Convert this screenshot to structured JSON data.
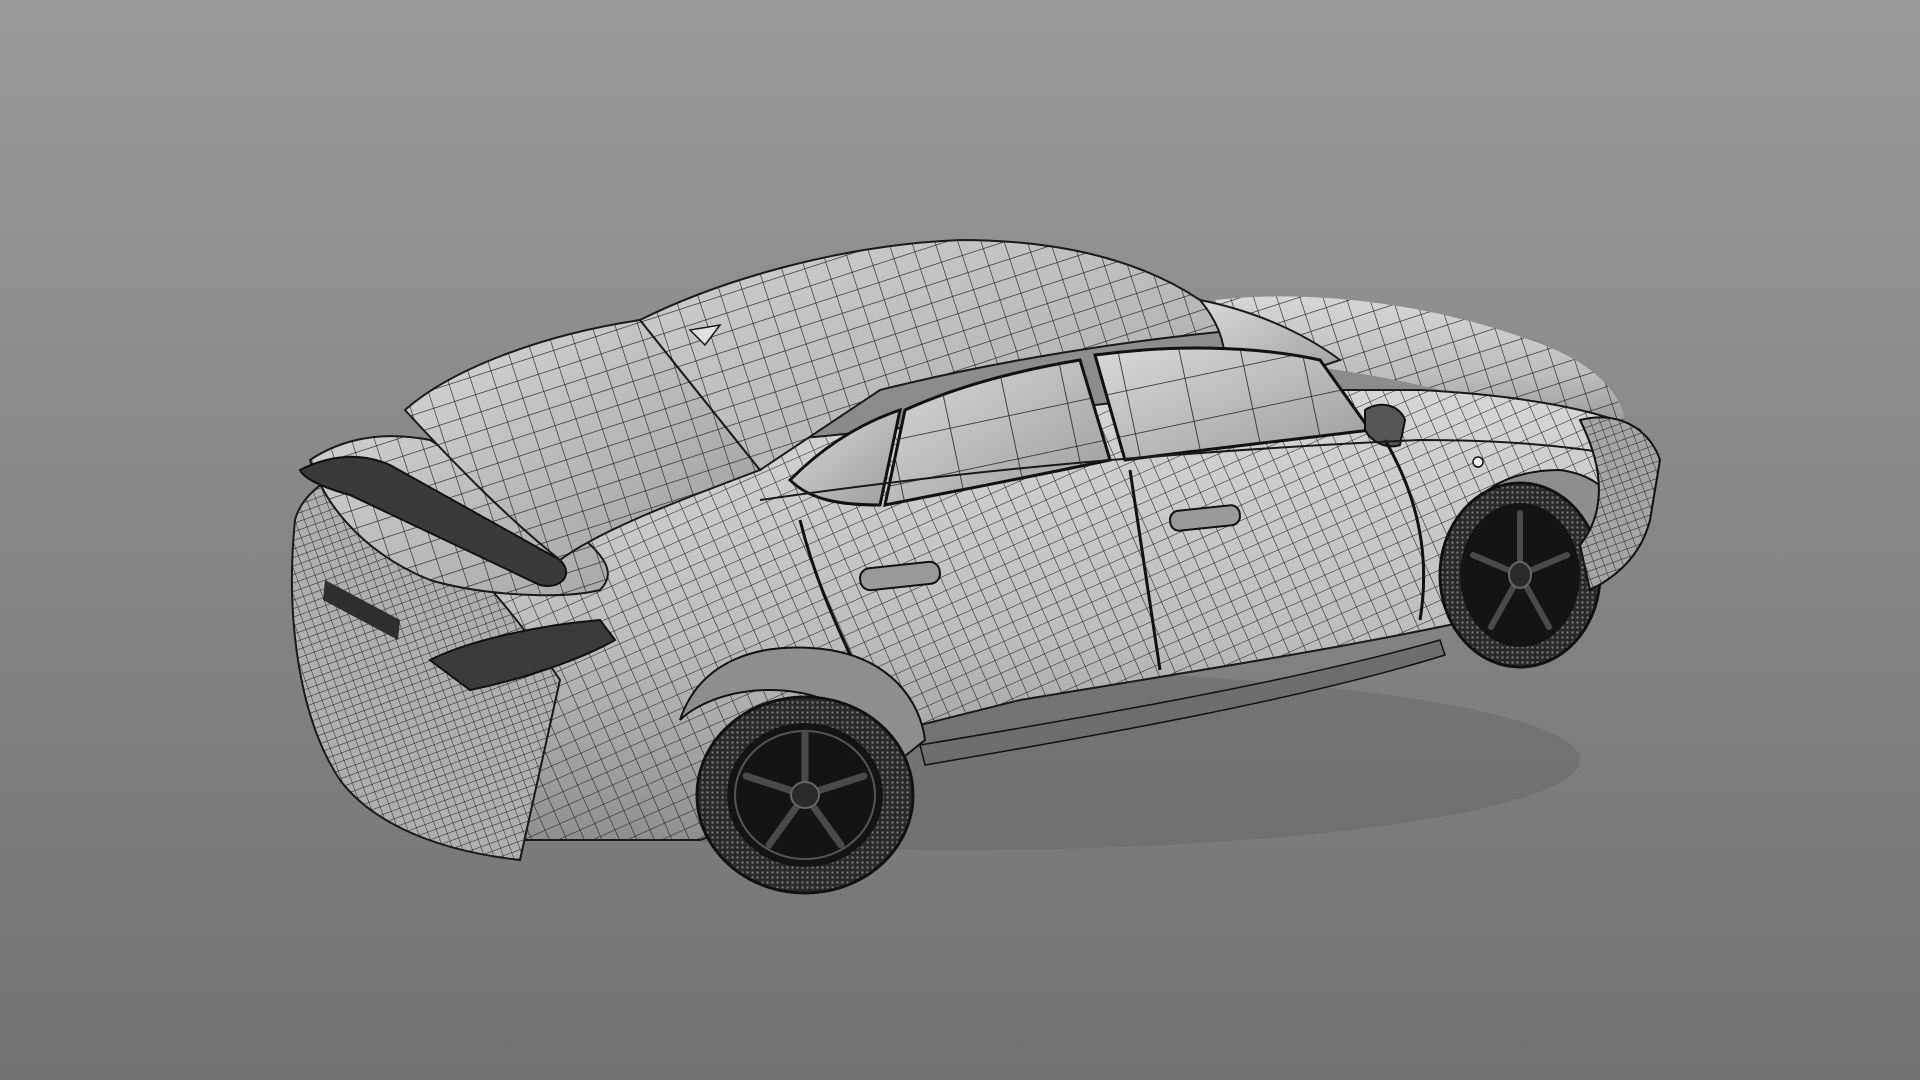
{
  "viewport": {
    "background_top": "#9a9a9a",
    "background_bottom": "#727272"
  },
  "model": {
    "subject": "car-wireframe",
    "mesh_line_color": "#1e1e1e",
    "surface_color": "#c9c9c9",
    "glass_color": "#b3b3b3",
    "tire_color": "#1a1a1a",
    "wheel_color": "#141414"
  }
}
